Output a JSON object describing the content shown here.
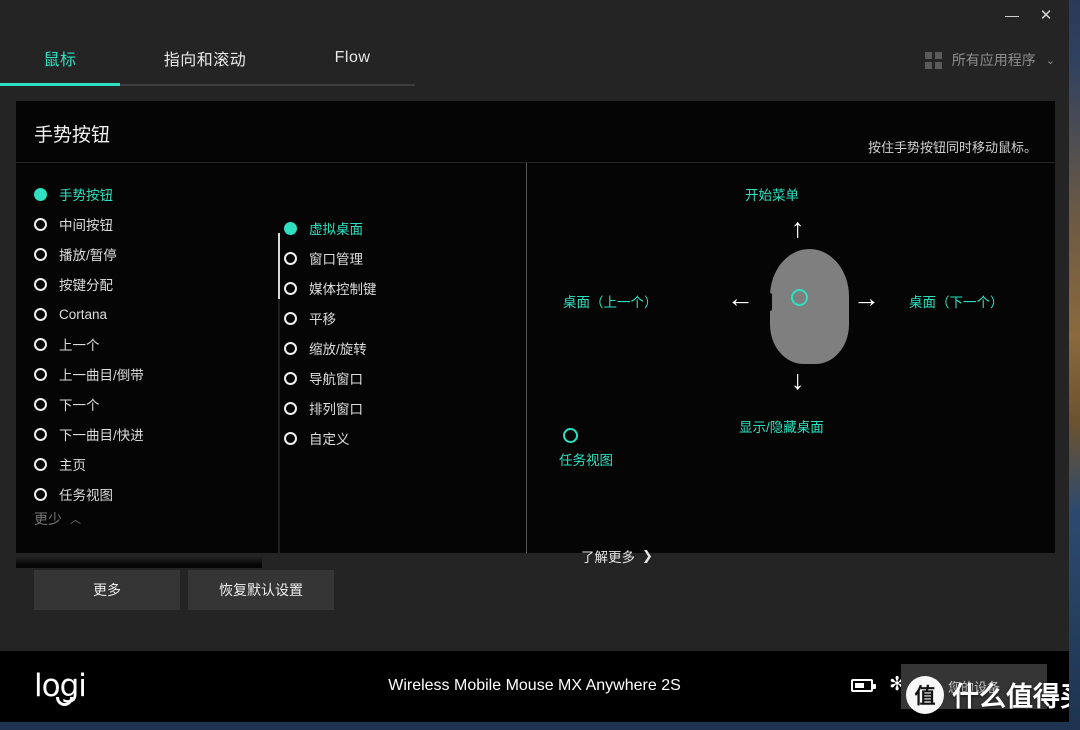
{
  "window": {
    "minimize_label": "—",
    "close_label": "✕"
  },
  "tabs": [
    {
      "label": "鼠标",
      "active": true
    },
    {
      "label": "指向和滚动",
      "active": false
    },
    {
      "label": "Flow",
      "active": false
    }
  ],
  "app_selector": {
    "icon": "grid-icon",
    "label": "所有应用程序",
    "caret": "⌄"
  },
  "panel": {
    "title": "手势按钮",
    "hint": "按住手势按钮同时移动鼠标。",
    "less_toggle": {
      "label": "更少",
      "caret": "︿"
    },
    "learn_more": {
      "label": "了解更多",
      "caret": "❯"
    }
  },
  "button_list": {
    "items": [
      {
        "label": "手势按钮",
        "selected": true
      },
      {
        "label": "中间按钮",
        "selected": false
      },
      {
        "label": "播放/暂停",
        "selected": false
      },
      {
        "label": "按键分配",
        "selected": false
      },
      {
        "label": "Cortana",
        "selected": false
      },
      {
        "label": "上一个",
        "selected": false
      },
      {
        "label": "上一曲目/倒带",
        "selected": false
      },
      {
        "label": "下一个",
        "selected": false
      },
      {
        "label": "下一曲目/快进",
        "selected": false
      },
      {
        "label": "主页",
        "selected": false
      },
      {
        "label": "任务视图",
        "selected": false
      }
    ]
  },
  "action_list": {
    "items": [
      {
        "label": "虚拟桌面",
        "selected": true
      },
      {
        "label": "窗口管理",
        "selected": false
      },
      {
        "label": "媒体控制键",
        "selected": false
      },
      {
        "label": "平移",
        "selected": false
      },
      {
        "label": "缩放/旋转",
        "selected": false
      },
      {
        "label": "导航窗口",
        "selected": false
      },
      {
        "label": "排列窗口",
        "selected": false
      },
      {
        "label": "自定义",
        "selected": false
      }
    ]
  },
  "gesture_diagram": {
    "up": {
      "label": "开始菜单",
      "arrow": "↑"
    },
    "down": {
      "label": "显示/隐藏桌面",
      "arrow": "↓"
    },
    "left": {
      "label": "桌面（上一个）",
      "arrow": "←"
    },
    "right": {
      "label": "桌面（下一个）",
      "arrow": "→"
    },
    "click": {
      "label": "任务视图"
    }
  },
  "actions": {
    "more_label": "更多",
    "reset_label": "恢复默认设置"
  },
  "footer": {
    "brand": "logi",
    "device_name": "Wireless Mobile Mouse MX Anywhere 2S",
    "battery_icon": "battery-icon",
    "bluetooth_icon": "✻",
    "device_button_label": "您的设备"
  },
  "watermark": {
    "badge": "值",
    "text": "什么值得买"
  },
  "colors": {
    "accent": "#2de0c0",
    "panel_bg": "#050505",
    "window_bg": "#242424",
    "button_bg": "#353535",
    "mouse_body": "#7f7f7f"
  }
}
